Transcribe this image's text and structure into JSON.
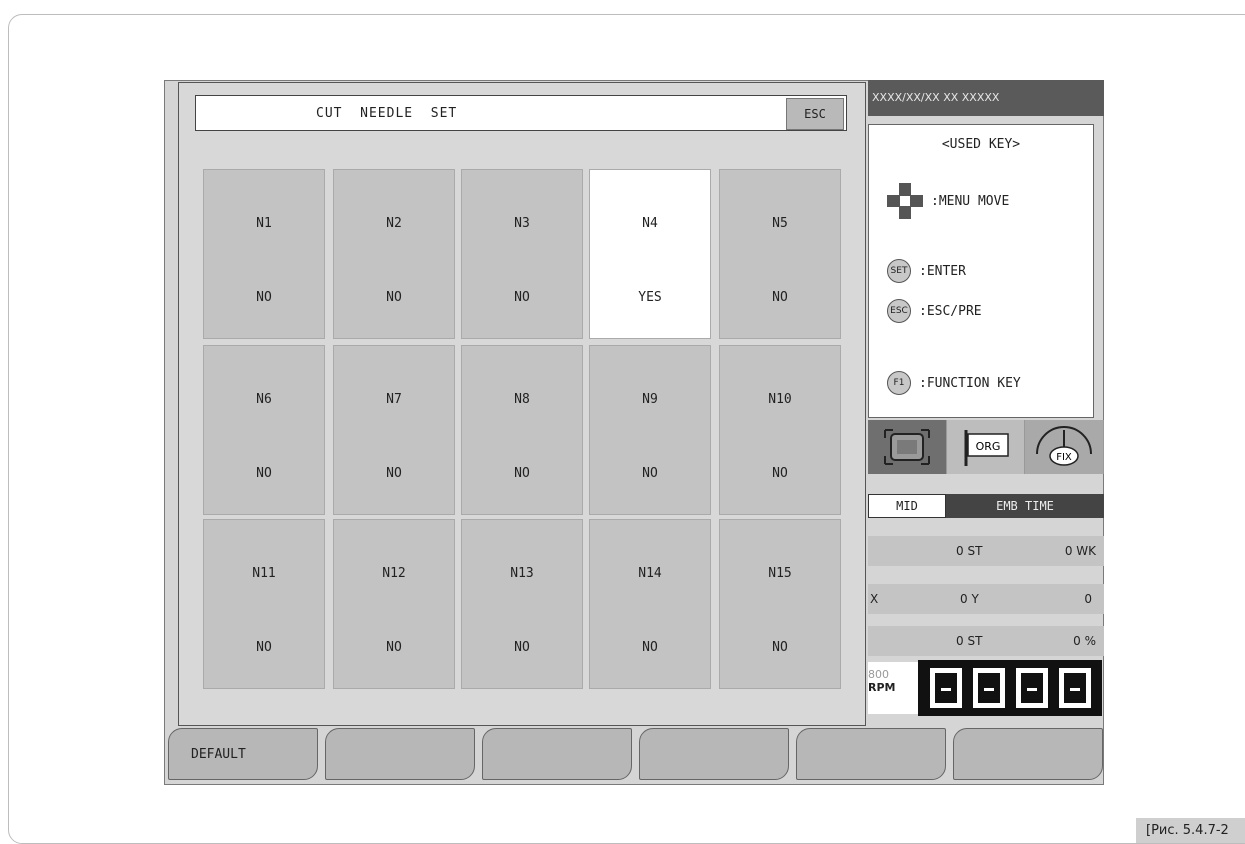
{
  "status_bar": {
    "text": "XXXX/XX/XX XX XXXXX"
  },
  "dialog": {
    "title": "CUT  NEEDLE  SET",
    "esc_label": "ESC",
    "needles": [
      {
        "name": "N1",
        "value": "NO",
        "selected": false
      },
      {
        "name": "N2",
        "value": "NO",
        "selected": false
      },
      {
        "name": "N3",
        "value": "NO",
        "selected": false
      },
      {
        "name": "N4",
        "value": "YES",
        "selected": true
      },
      {
        "name": "N5",
        "value": "NO",
        "selected": false
      },
      {
        "name": "N6",
        "value": "NO",
        "selected": false
      },
      {
        "name": "N7",
        "value": "NO",
        "selected": false
      },
      {
        "name": "N8",
        "value": "NO",
        "selected": false
      },
      {
        "name": "N9",
        "value": "NO",
        "selected": false
      },
      {
        "name": "N10",
        "value": "NO",
        "selected": false
      },
      {
        "name": "N11",
        "value": "NO",
        "selected": false
      },
      {
        "name": "N12",
        "value": "NO",
        "selected": false
      },
      {
        "name": "N13",
        "value": "NO",
        "selected": false
      },
      {
        "name": "N14",
        "value": "NO",
        "selected": false
      },
      {
        "name": "N15",
        "value": "NO",
        "selected": false
      }
    ]
  },
  "used_keys": {
    "title": "<USED  KEY>",
    "menu_move": ":MENU  MOVE",
    "set_icon": "SET",
    "enter": ":ENTER",
    "esc_icon": "ESC",
    "esc_pre": ":ESC/PRE",
    "f1_icon": "F1",
    "function_key": ":FUNCTION  KEY"
  },
  "mode_icons": {
    "org": "ORG",
    "fix": "FIX",
    "mid": "MID",
    "emb_time": "EMB  TIME"
  },
  "stats": {
    "row1": {
      "st": "0 ST",
      "wk": "0 WK"
    },
    "row2": {
      "x": "X",
      "y": "0 Y",
      "val": "0"
    },
    "row3": {
      "st": "0 ST",
      "pct": "0 %"
    }
  },
  "rpm": {
    "value": "800",
    "unit": "RPM"
  },
  "function_keys": [
    "DEFAULT",
    "",
    "",
    "",
    "",
    ""
  ],
  "caption": "[Рис. 5.4.7-2"
}
